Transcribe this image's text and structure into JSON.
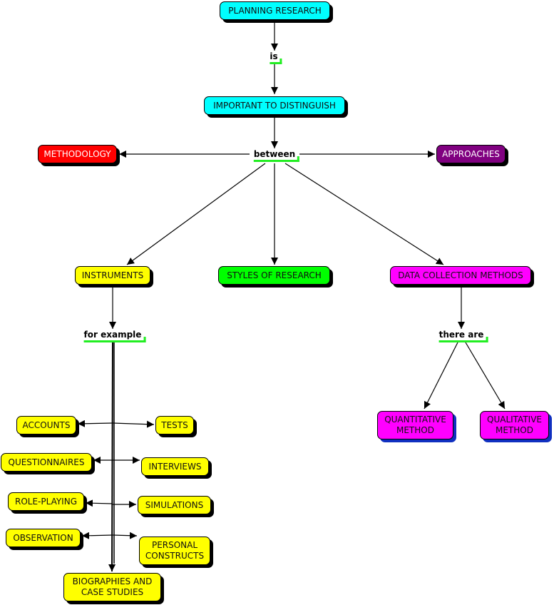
{
  "nodes": {
    "planning_research": "PLANNING RESEARCH",
    "important_to_distinguish": "IMPORTANT TO DISTINGUISH",
    "methodology": "METHODOLOGY",
    "approaches": "APPROACHES",
    "instruments": "INSTRUMENTS",
    "styles_of_research": "STYLES OF RESEARCH",
    "data_collection_methods": "DATA COLLECTION METHODS",
    "quantitative_method": "QUANTITATIVE METHOD",
    "qualitative_method": "QUALITATIVE METHOD",
    "accounts": "ACCOUNTS",
    "tests": "TESTS",
    "questionnaires": "QUESTIONNAIRES",
    "interviews": "INTERVIEWS",
    "role_playing": "ROLE-PLAYING",
    "simulations": "SIMULATIONS",
    "observation": "OBSERVATION",
    "personal_constructs": "PERSONAL CONSTRUCTS",
    "biographies": "BIOGRAPHIES AND CASE STUDIES"
  },
  "links": {
    "is": "is",
    "between": "between",
    "for_example": "for example",
    "there_are": "there are"
  },
  "colors": {
    "cyan": "#00ffff",
    "red": "#ff0000",
    "purple": "#800080",
    "yellow": "#ffff00",
    "green": "#00ff00",
    "magenta": "#ff00ff",
    "link_underline": "#22ee22"
  }
}
